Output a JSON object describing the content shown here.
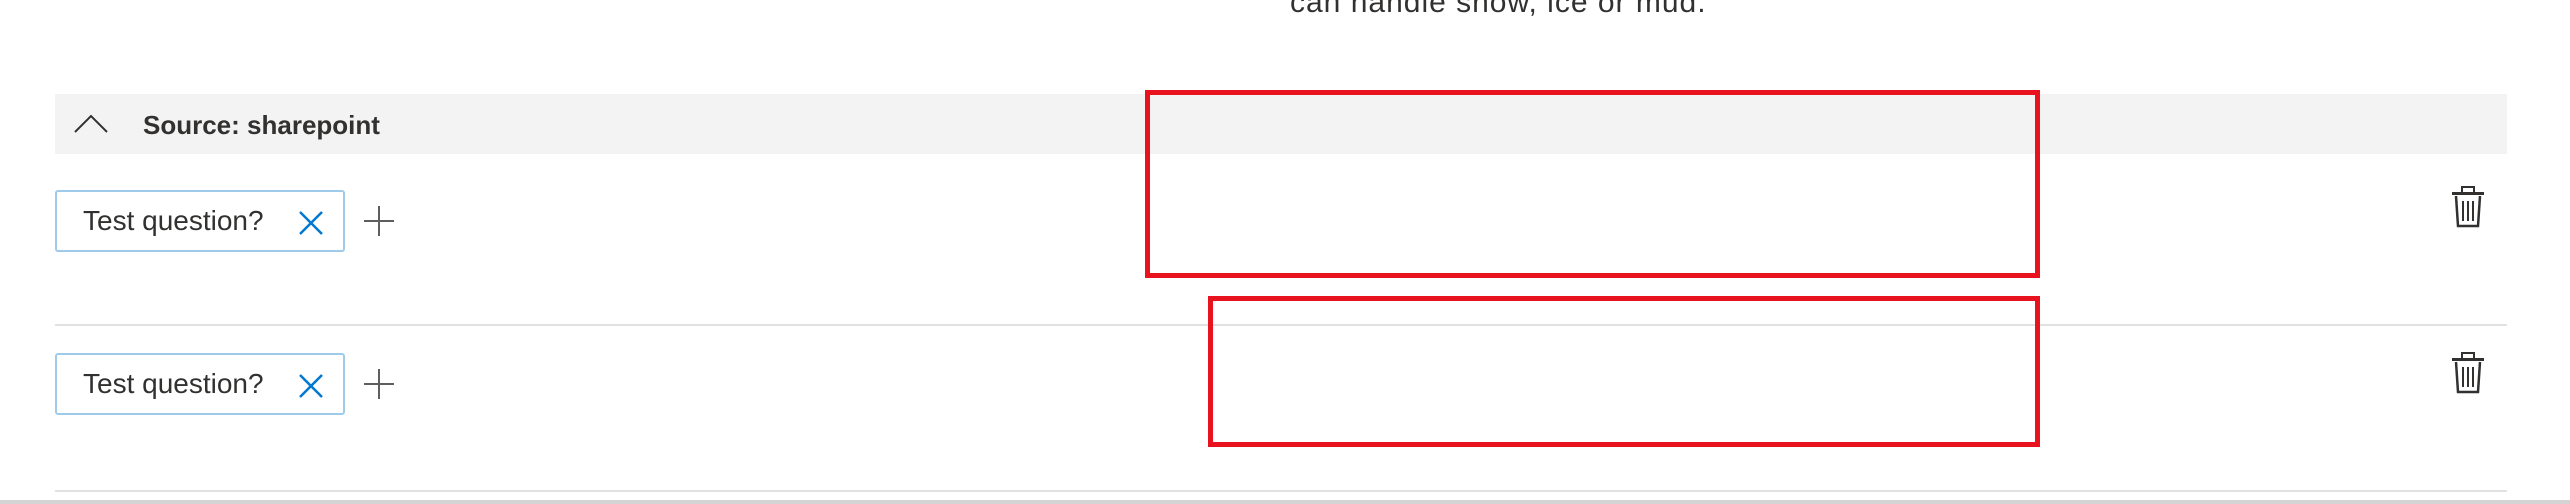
{
  "previous_answer": {
    "text": "can handle snow, ice or mud."
  },
  "source": {
    "title": "Source: sharepoint",
    "collapse_icon": "chevron-up-icon"
  },
  "rows": [
    {
      "question": "Test question?",
      "answer": "",
      "remove_icon": "close-icon",
      "add_icon": "plus-icon",
      "delete_icon": "trash-icon"
    },
    {
      "question": "Test question?",
      "answer": "",
      "remove_icon": "close-icon",
      "add_icon": "plus-icon",
      "delete_icon": "trash-icon"
    }
  ],
  "colors": {
    "header_bg": "#f3f3f3",
    "tag_border": "#9ecbe9",
    "remove_icon": "#0078d4",
    "highlight_border": "#e8131f",
    "divider": "#e1e1e1"
  }
}
